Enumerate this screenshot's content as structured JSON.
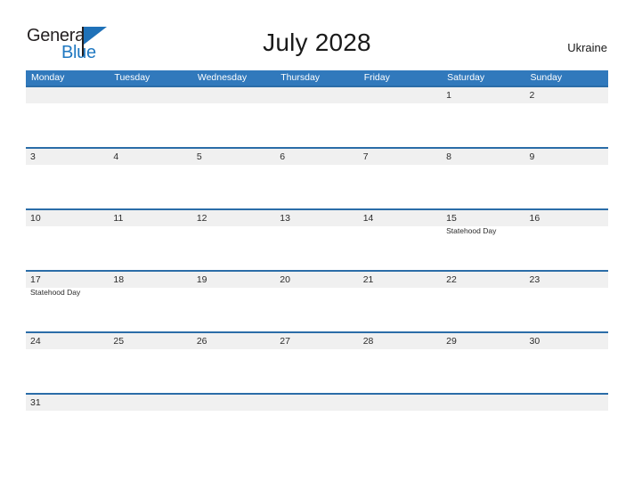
{
  "brand": {
    "name_part1": "General",
    "name_part2": "Blue",
    "icon": "flag-triangle-icon",
    "color_dark": "#231f20",
    "color_blue": "#1f78c1"
  },
  "header": {
    "title": "July 2028",
    "country": "Ukraine"
  },
  "theme": {
    "header_blue": "#3179bc",
    "separator_blue": "#2b6da8",
    "date_band_gray": "#f0f0f0",
    "text_dark": "#2b2b2b",
    "page_background": "#ffffff"
  },
  "calendar": {
    "weekdays": [
      "Monday",
      "Tuesday",
      "Wednesday",
      "Thursday",
      "Friday",
      "Saturday",
      "Sunday"
    ],
    "weeks": [
      [
        {
          "date": "",
          "events": []
        },
        {
          "date": "",
          "events": []
        },
        {
          "date": "",
          "events": []
        },
        {
          "date": "",
          "events": []
        },
        {
          "date": "",
          "events": []
        },
        {
          "date": "1",
          "events": []
        },
        {
          "date": "2",
          "events": []
        }
      ],
      [
        {
          "date": "3",
          "events": []
        },
        {
          "date": "4",
          "events": []
        },
        {
          "date": "5",
          "events": []
        },
        {
          "date": "6",
          "events": []
        },
        {
          "date": "7",
          "events": []
        },
        {
          "date": "8",
          "events": []
        },
        {
          "date": "9",
          "events": []
        }
      ],
      [
        {
          "date": "10",
          "events": []
        },
        {
          "date": "11",
          "events": []
        },
        {
          "date": "12",
          "events": []
        },
        {
          "date": "13",
          "events": []
        },
        {
          "date": "14",
          "events": []
        },
        {
          "date": "15",
          "events": [
            "Statehood Day"
          ]
        },
        {
          "date": "16",
          "events": []
        }
      ],
      [
        {
          "date": "17",
          "events": [
            "Statehood Day"
          ]
        },
        {
          "date": "18",
          "events": []
        },
        {
          "date": "19",
          "events": []
        },
        {
          "date": "20",
          "events": []
        },
        {
          "date": "21",
          "events": []
        },
        {
          "date": "22",
          "events": []
        },
        {
          "date": "23",
          "events": []
        }
      ],
      [
        {
          "date": "24",
          "events": []
        },
        {
          "date": "25",
          "events": []
        },
        {
          "date": "26",
          "events": []
        },
        {
          "date": "27",
          "events": []
        },
        {
          "date": "28",
          "events": []
        },
        {
          "date": "29",
          "events": []
        },
        {
          "date": "30",
          "events": []
        }
      ],
      [
        {
          "date": "31",
          "events": []
        },
        {
          "date": "",
          "events": []
        },
        {
          "date": "",
          "events": []
        },
        {
          "date": "",
          "events": []
        },
        {
          "date": "",
          "events": []
        },
        {
          "date": "",
          "events": []
        },
        {
          "date": "",
          "events": []
        }
      ]
    ]
  }
}
